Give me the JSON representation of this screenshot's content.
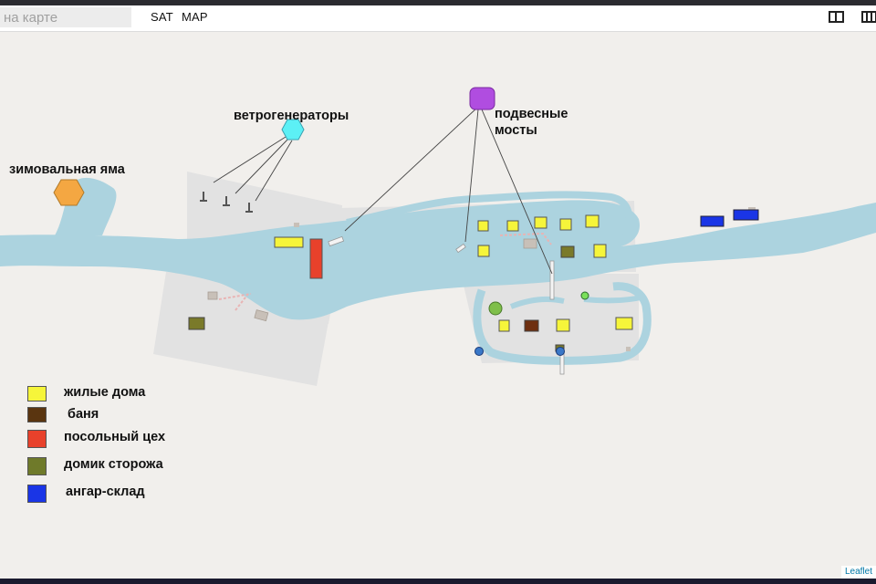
{
  "toolbar": {
    "search_placeholder": "на карте",
    "sat_label": "SAT",
    "map_label": "MAP"
  },
  "map": {
    "labels": {
      "wind_generators": "ветрогенераторы",
      "suspension_bridges_line1": "подвесные",
      "suspension_bridges_line2": "мосты",
      "wintering_pit": "зимовальная яма"
    },
    "colors": {
      "water": "#acd3df",
      "land_area": "#e2e2e2",
      "wind_hex": "#5cf0f5",
      "bridge_marker": "#b04de0",
      "pit_hex": "#f4a742",
      "house": "#f6f53a",
      "bath": "#6e2f10",
      "salting": "#e8412b",
      "guard": "#7a7a2a",
      "hangar": "#1a35e6"
    }
  },
  "legend": {
    "items": [
      {
        "label": "жилые дома",
        "color": "#f6f53a"
      },
      {
        "label": "баня",
        "color": "#5a3510"
      },
      {
        "label": "посольный цех",
        "color": "#e8412b"
      },
      {
        "label": "домик сторожа",
        "color": "#6f7a2a"
      },
      {
        "label": "ангар-склад",
        "color": "#1a35e6"
      }
    ]
  },
  "attribution": "Leaflet"
}
